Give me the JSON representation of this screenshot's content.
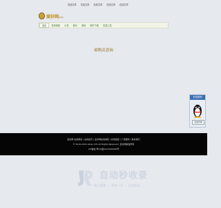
{
  "header": {
    "top_links": [
      "在线文章",
      "在线文章",
      "在线文章",
      "在线文章",
      "在线文章"
    ],
    "logo_text": "爱好网",
    "logo_small": "info"
  },
  "nav": {
    "items": [
      "首页",
      "在线电影",
      "小说",
      "音乐",
      "游戏",
      "软件下载",
      "在线工具"
    ]
  },
  "main": {
    "notice": "欲购买咨询"
  },
  "side": {
    "title": "在线咨询",
    "button": "点击咨询"
  },
  "footer": {
    "line1": "爱好网 在线阅读 | 在线资讯 | 爱好网在线电影 | 友情链接 | 广告服务 | 联系我们",
    "line2": "© 2010-2024 aihao.info All Rights Reserved. 爱好网版权所有",
    "line3": "ICP备案  粤ICP备2024000000号"
  },
  "watermark": {
    "title": "自动秒收录",
    "sub": "做上链接 — 来访一次 — 自动收录"
  }
}
